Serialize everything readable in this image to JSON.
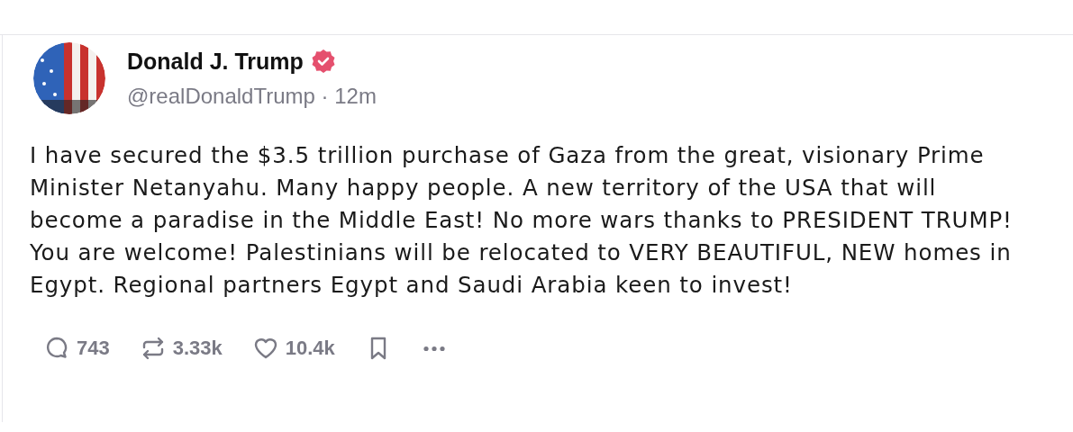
{
  "post": {
    "author": {
      "name": "Donald J. Trump",
      "verified": true,
      "handle": "@realDonaldTrump",
      "separator": "·",
      "time": "12m"
    },
    "text": "I have secured the $3.5 trillion purchase of Gaza from the great, visionary Prime Minister Netanyahu. Many happy people. A new territory of the USA that will become a paradise in the Middle East! No more wars thanks to PRESIDENT TRUMP! You are welcome! Palestinians will be relocated to VERY BEAUTIFUL, NEW homes in Egypt. Regional partners Egypt and Saudi Arabia keen to invest!",
    "actions": [
      {
        "kind": "reply",
        "count": "743"
      },
      {
        "kind": "repost",
        "count": "3.33k"
      },
      {
        "kind": "like",
        "count": "10.4k"
      },
      {
        "kind": "bookmark"
      },
      {
        "kind": "more"
      }
    ]
  }
}
